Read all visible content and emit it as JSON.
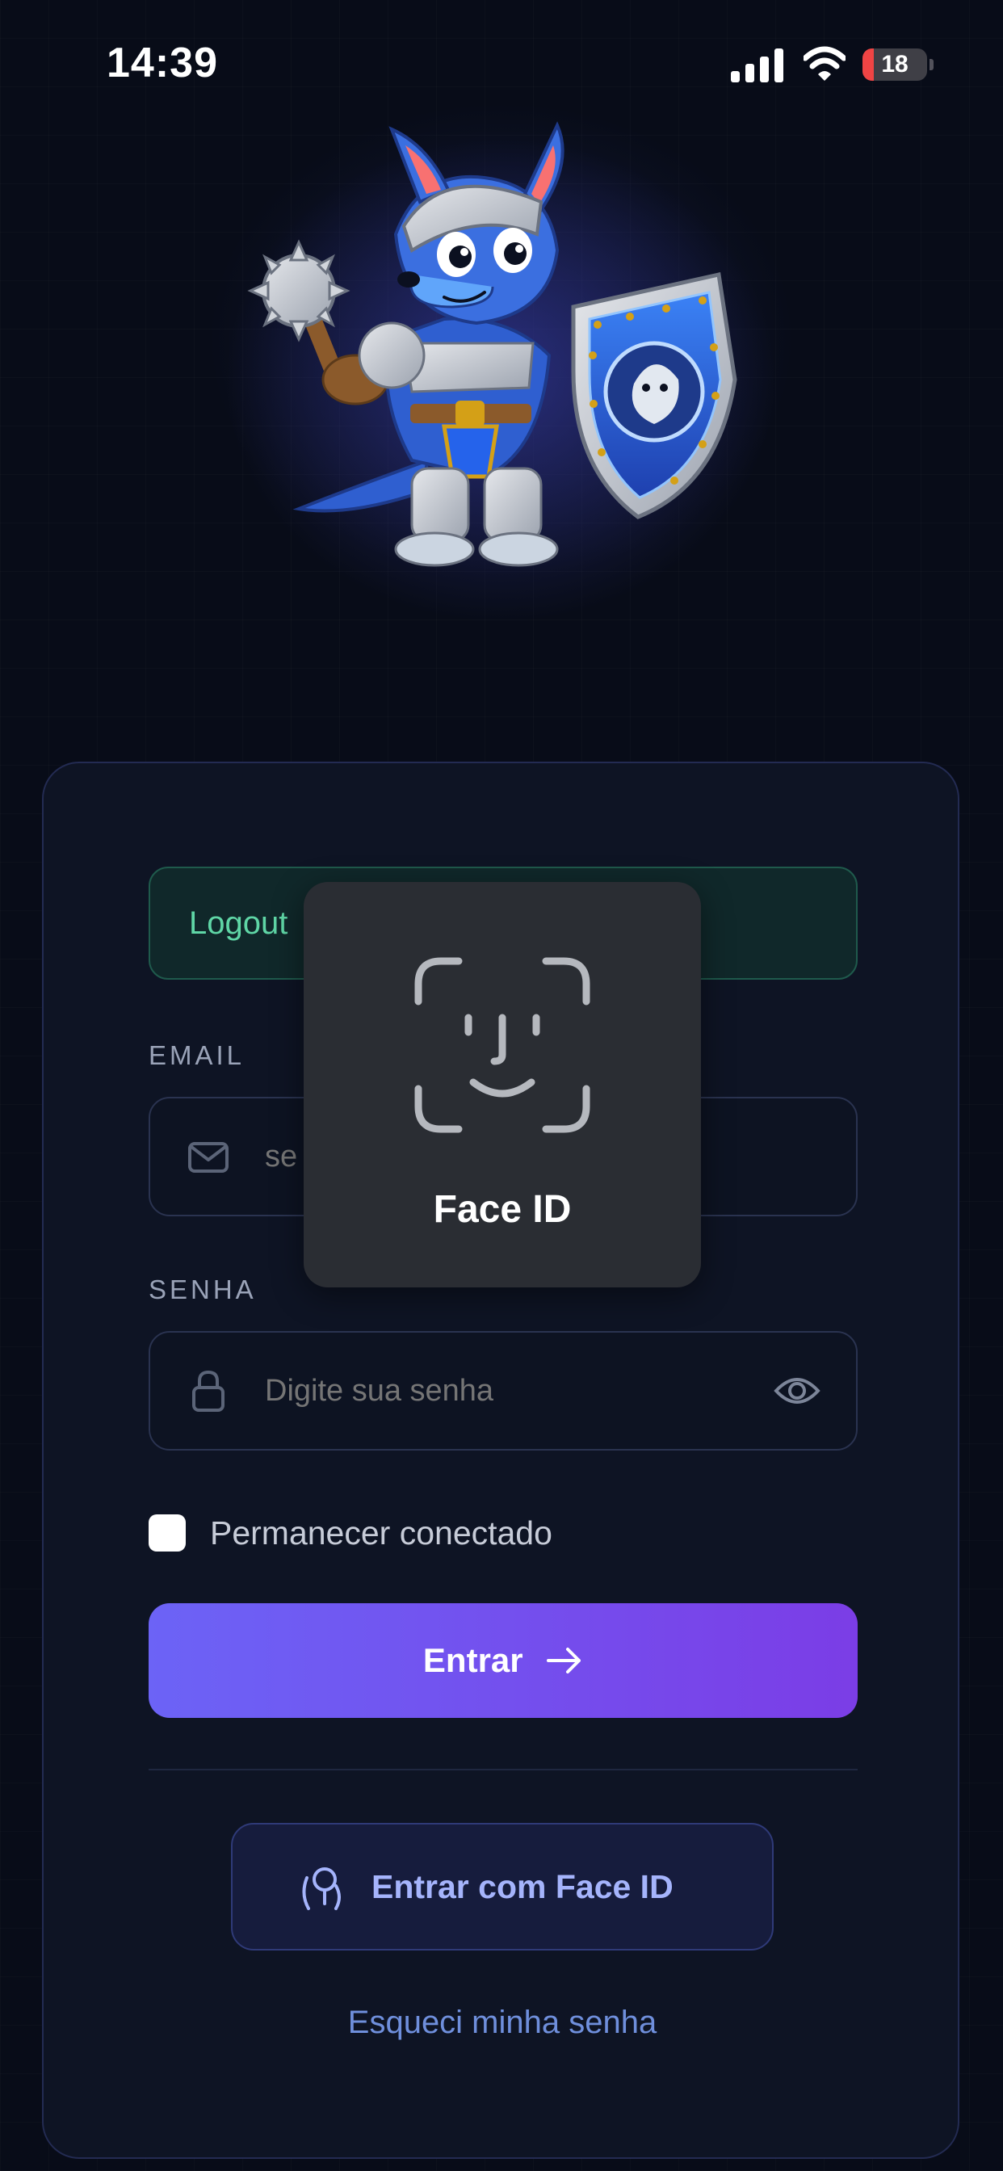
{
  "status_bar": {
    "time": "14:39",
    "battery": "18"
  },
  "alert": {
    "text": "Logout"
  },
  "email": {
    "label": "EMAIL",
    "placeholder": "se"
  },
  "password": {
    "label": "SENHA",
    "placeholder": "Digite sua senha"
  },
  "remember": {
    "label": "Permanecer conectado",
    "checked": false
  },
  "primary_button": {
    "label": "Entrar"
  },
  "face_id_button": {
    "label": "Entrar com Face ID"
  },
  "forgot_link": {
    "label": "Esqueci minha senha"
  },
  "face_id_overlay": {
    "label": "Face ID"
  },
  "colors": {
    "background": "#080c18",
    "card": "#0e1424",
    "accent_start": "#6c63f6",
    "accent_end": "#7b3de6",
    "success_text": "#5fd6a6",
    "link": "#6f8fdc",
    "battery_low": "#ef4444"
  },
  "icons": {
    "signal": "cellular-signal-icon",
    "wifi": "wifi-icon",
    "battery": "battery-icon",
    "email": "mail-icon",
    "password": "lock-icon",
    "reveal": "eye-icon",
    "submit": "arrow-right-icon",
    "biometric": "face-id-icon"
  }
}
